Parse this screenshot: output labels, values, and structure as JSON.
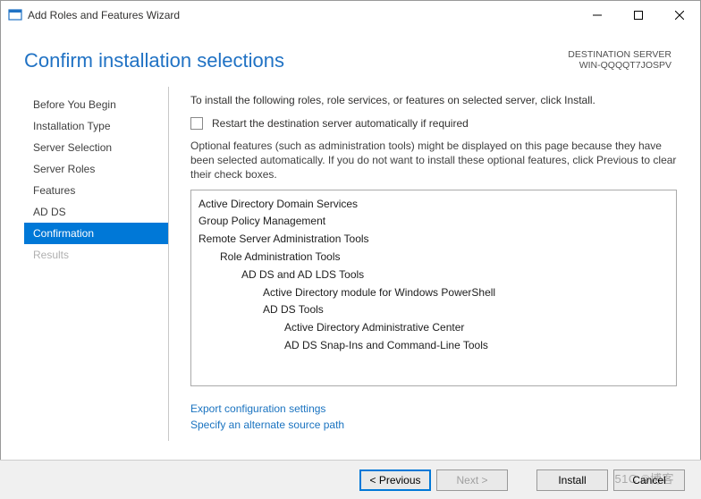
{
  "window": {
    "title": "Add Roles and Features Wizard"
  },
  "header": {
    "title": "Confirm installation selections",
    "destLabel": "DESTINATION SERVER",
    "destServer": "WIN-QQQQT7JOSPV"
  },
  "sidebar": {
    "items": [
      {
        "label": "Before You Begin",
        "state": "normal"
      },
      {
        "label": "Installation Type",
        "state": "normal"
      },
      {
        "label": "Server Selection",
        "state": "normal"
      },
      {
        "label": "Server Roles",
        "state": "normal"
      },
      {
        "label": "Features",
        "state": "normal"
      },
      {
        "label": "AD DS",
        "state": "normal"
      },
      {
        "label": "Confirmation",
        "state": "active"
      },
      {
        "label": "Results",
        "state": "disabled"
      }
    ]
  },
  "content": {
    "intro": "To install the following roles, role services, or features on selected server, click Install.",
    "checkbox": {
      "checked": false,
      "label": "Restart the destination server automatically if required"
    },
    "note": "Optional features (such as administration tools) might be displayed on this page because they have been selected automatically. If you do not want to install these optional features, click Previous to clear their check boxes.",
    "list": [
      {
        "indent": 0,
        "text": "Active Directory Domain Services"
      },
      {
        "indent": 0,
        "text": "Group Policy Management"
      },
      {
        "indent": 0,
        "text": "Remote Server Administration Tools"
      },
      {
        "indent": 1,
        "text": "Role Administration Tools"
      },
      {
        "indent": 2,
        "text": "AD DS and AD LDS Tools"
      },
      {
        "indent": 3,
        "text": "Active Directory module for Windows PowerShell"
      },
      {
        "indent": 3,
        "text": "AD DS Tools"
      },
      {
        "indent": 4,
        "text": "Active Directory Administrative Center"
      },
      {
        "indent": 4,
        "text": "AD DS Snap-Ins and Command-Line Tools"
      }
    ],
    "links": {
      "export": "Export configuration settings",
      "altpath": "Specify an alternate source path"
    }
  },
  "footer": {
    "previous": "< Previous",
    "next": "Next >",
    "install": "Install",
    "cancel": "Cancel"
  },
  "watermark": "51C ©博客"
}
